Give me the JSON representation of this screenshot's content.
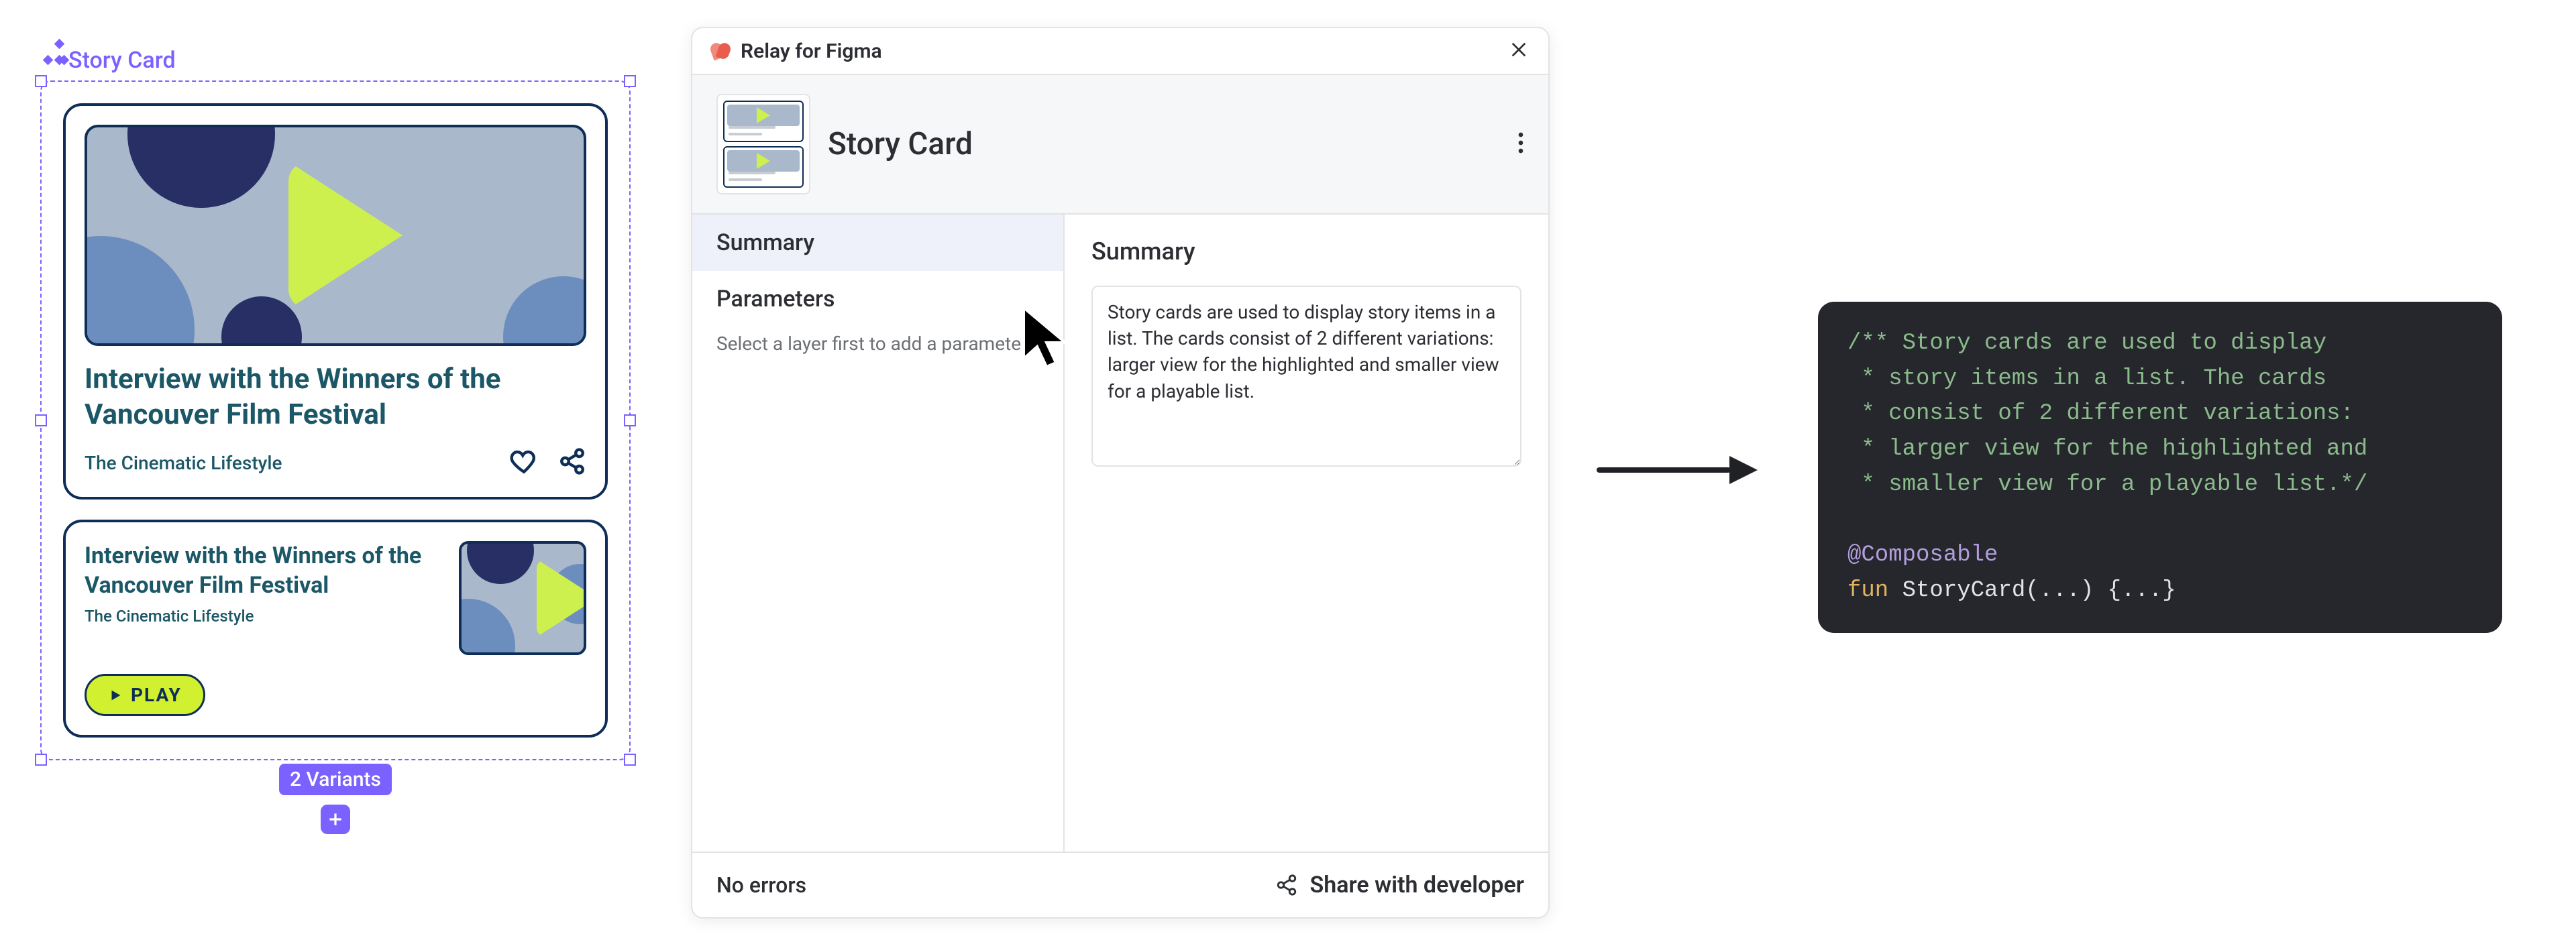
{
  "figma_frame": {
    "component_label": "Story Card",
    "variants_badge": "2 Variants",
    "card_large": {
      "title": "Interview with the Winners of the Vancouver Film Festival",
      "subtitle": "The Cinematic Lifestyle"
    },
    "card_small": {
      "title": "Interview with the Winners of the Vancouver Film Festival",
      "subtitle": "The Cinematic Lifestyle",
      "play_label": "PLAY"
    }
  },
  "relay_panel": {
    "title": "Relay for Figma",
    "component_name": "Story Card",
    "tabs": {
      "summary": "Summary",
      "parameters": "Parameters",
      "parameters_hint": "Select a layer first to add a parameter"
    },
    "content": {
      "heading": "Summary",
      "summary_text": "Story cards are used to display story items in a list. The cards consist of 2 different variations: larger view for the highlighted and smaller view for a playable list."
    },
    "footer": {
      "status": "No errors",
      "share_label": "Share with developer"
    }
  },
  "code": {
    "comment_lines": [
      "/** Story cards are used to display",
      " * story items in a list. The cards",
      " * consist of 2 different variations:",
      " * larger view for the highlighted and",
      " * smaller view for a playable list.*/"
    ],
    "annotation": "@Composable",
    "fun_kw": "fun ",
    "fn_name": "StoryCard",
    "fn_rest": "(...) {...}"
  }
}
